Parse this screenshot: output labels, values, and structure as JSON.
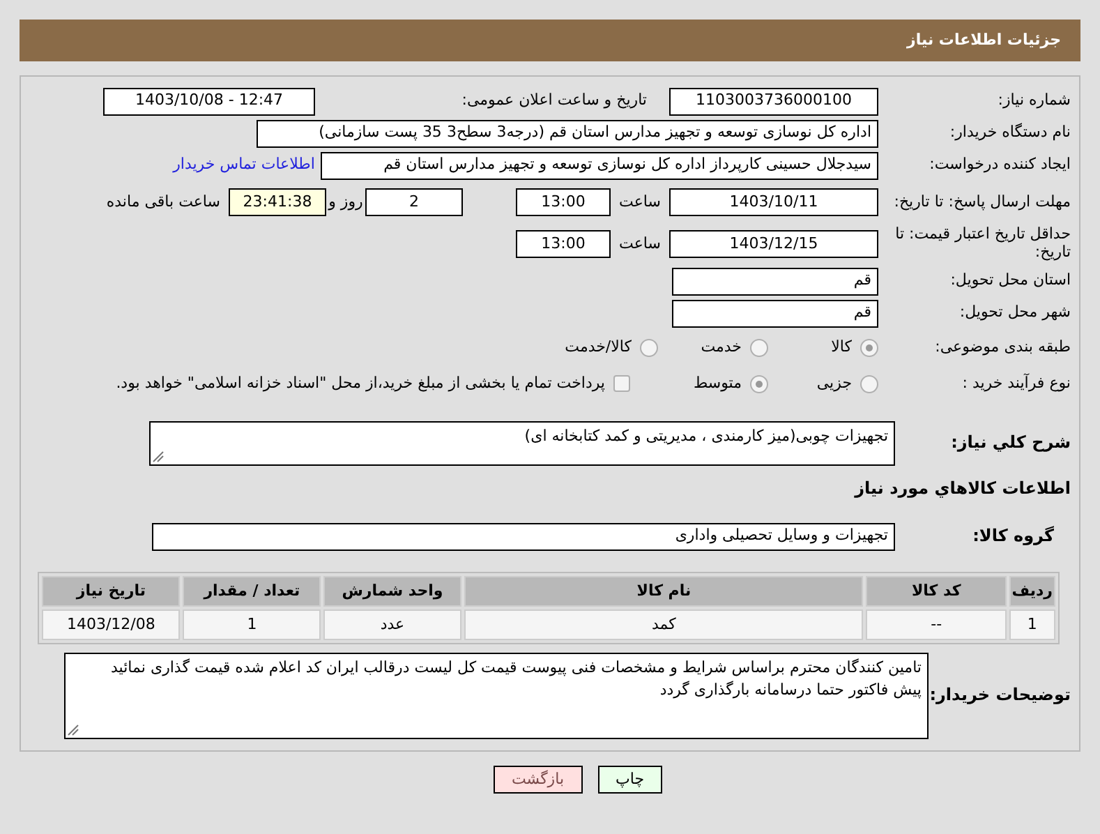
{
  "header": {
    "title": "جزئیات اطلاعات نیاز"
  },
  "need_number": {
    "label": "شماره نیاز:",
    "value": "1103003736000100"
  },
  "announce": {
    "label": "تاریخ و ساعت اعلان عمومی:",
    "value": "1403/10/08 - 12:47"
  },
  "buyer": {
    "label": "نام دستگاه خریدار:",
    "value": "اداره کل نوسازی   توسعه و تجهیز مدارس استان قم (درجه3 سطح3  35 پست سازمانی)"
  },
  "creator": {
    "label": "ایجاد کننده درخواست:",
    "value": "سیدجلال حسینی کارپرداز اداره کل نوسازی   توسعه و تجهیز مدارس استان قم",
    "link": "اطلاعات تماس خریدار"
  },
  "deadline": {
    "label": "مهلت ارسال پاسخ: تا تاریخ:",
    "date": "1403/10/11",
    "time_label": "ساعت",
    "time": "13:00",
    "days": "2",
    "days_label": "روز و",
    "remaining": "23:41:38",
    "remaining_label": "ساعت باقی مانده"
  },
  "validity": {
    "label": "حداقل تاریخ اعتبار قیمت: تا تاریخ:",
    "date": "1403/12/15",
    "time_label": "ساعت",
    "time": "13:00"
  },
  "province": {
    "label": "استان محل تحویل:",
    "value": "قم"
  },
  "city": {
    "label": "شهر محل تحویل:",
    "value": "قم"
  },
  "category": {
    "label": "طبقه بندی موضوعی:",
    "options": [
      {
        "label": "کالا",
        "selected": true
      },
      {
        "label": "خدمت",
        "selected": false
      },
      {
        "label": "کالا/خدمت",
        "selected": false
      }
    ]
  },
  "process": {
    "label": "نوع فرآیند خرید :",
    "options": [
      {
        "label": "جزیی",
        "selected": false
      },
      {
        "label": "متوسط",
        "selected": true
      }
    ],
    "payment": {
      "label": "پرداخت تمام یا بخشی از مبلغ خرید،از محل \"اسناد خزانه اسلامی\" خواهد بود.",
      "checked": false
    }
  },
  "description": {
    "label": "شرح کلي نياز:",
    "value": "تجهیزات چوبی(میز کارمندی ، مدیریتی و کمد کتابخانه ای)"
  },
  "goods_title": "اطلاعات کالاهاي مورد نياز",
  "goods_group": {
    "label": "گروه کالا:",
    "value": "تجهیزات و وسایل تحصیلی واداری"
  },
  "table": {
    "columns": [
      "ردیف",
      "کد کالا",
      "نام کالا",
      "واحد شمارش",
      "تعداد / مقدار",
      "تاریخ نیاز"
    ],
    "rows": [
      [
        "1",
        "--",
        "کمد",
        "عدد",
        "1",
        "1403/12/08"
      ]
    ]
  },
  "notes": {
    "label": "توضیحات خریدار:",
    "lines": [
      "تامین کنندگان محترم براساس شرایط و مشخصات فنی پیوست قیمت کل لیست درقالب ایران کد اعلام شده قیمت گذاری نمائید",
      "پیش فاکتور حتما درسامانه بارگذاری گردد"
    ]
  },
  "buttons": [
    {
      "label": "چاپ",
      "kind": "print"
    },
    {
      "label": "بازگشت",
      "kind": "back"
    }
  ]
}
